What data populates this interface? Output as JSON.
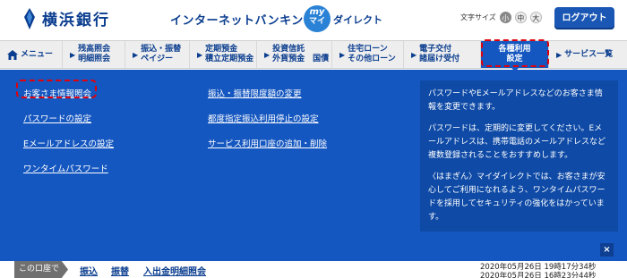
{
  "header": {
    "bank_name": "横浜銀行",
    "service_name": "インターネットバンキング",
    "my_badge_top": "my",
    "my_badge_bottom": "マイ",
    "my_label": "ダイレクト",
    "font_size_label": "文字サイズ",
    "font_sizes": [
      "小",
      "中",
      "大"
    ],
    "logout_label": "ログアウト"
  },
  "nav": {
    "items": [
      {
        "lines": [
          "メニュー"
        ],
        "icon": "home-icon"
      },
      {
        "lines": [
          "残高照会",
          "明細照会"
        ]
      },
      {
        "lines": [
          "振込・振替",
          "ペイジー"
        ]
      },
      {
        "lines": [
          "定期預金",
          "積立定期預金"
        ]
      },
      {
        "lines": [
          "投資信託",
          "外貨預金　国債"
        ]
      },
      {
        "lines": [
          "住宅ローン",
          "その他ローン"
        ]
      },
      {
        "lines": [
          "電子交付",
          "諸届け受付"
        ]
      },
      {
        "lines": [
          "各種利用",
          "設定"
        ],
        "active": true
      },
      {
        "lines": [
          "サービス一覧"
        ]
      }
    ]
  },
  "panel": {
    "col1": [
      "お客さま情報照会",
      "パスワードの設定",
      "Eメールアドレスの設定",
      "ワンタイムパスワード"
    ],
    "col2": [
      "振込・振替限度額の変更",
      "都度指定振込利用停止の設定",
      "サービス利用口座の追加・削除"
    ],
    "info_paragraphs": [
      "パスワードやEメールアドレスなどのお客さま情報を変更できます。",
      "パスワードは、定期的に変更してください。Eメールアドレスは、携帯電話のメールアドレスなど複数登録されることをおすすめします。",
      "〈はまぎん〉マイダイレクトでは、お客さまが安心してご利用になれるよう、ワンタイムパスワードを採用してセキュリティの強化をはかっています。"
    ],
    "close_label": "×"
  },
  "bottom": {
    "account_label": "この口座で",
    "links": [
      "振込",
      "振替",
      "入出金明細照会"
    ],
    "timestamps": [
      "2020年05月26日 19時17分34秒",
      "2020年05月26日 16時23分44秒"
    ]
  },
  "colors": {
    "brand_blue": "#0a3d8f",
    "panel_blue": "#1557c0",
    "info_blue": "#0e4aa6",
    "highlight_red": "#e0000b"
  }
}
